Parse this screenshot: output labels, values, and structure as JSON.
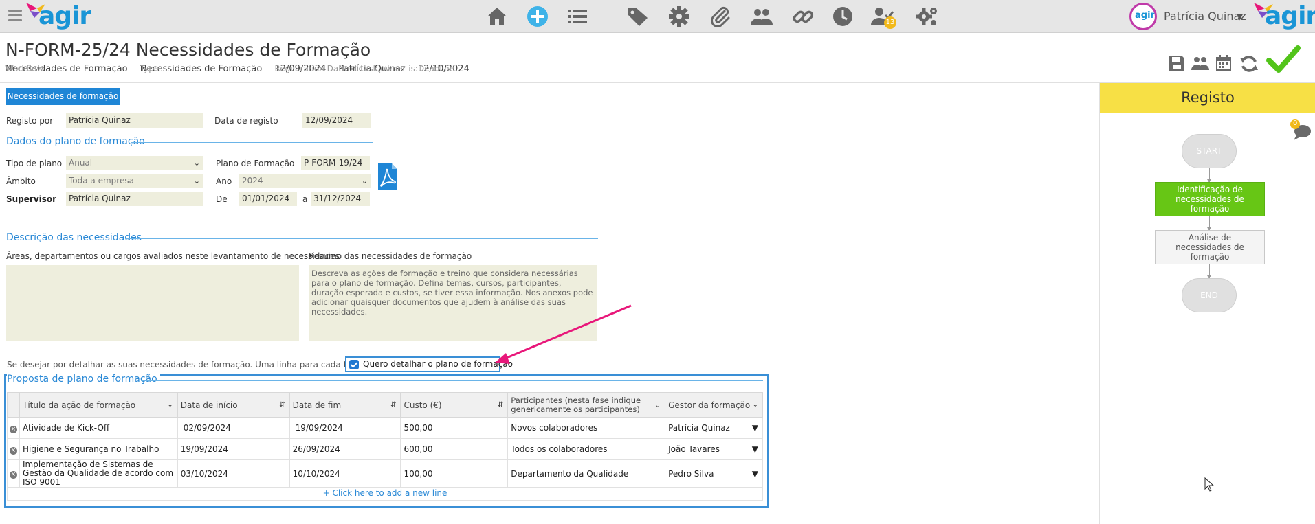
{
  "topbar": {
    "logo_text": "agir",
    "badge_count": "13",
    "user_name": "Patrícia Quinaz",
    "user_initials": "agir",
    "nav_icons": [
      "home-icon",
      "add-icon",
      "list-icon",
      "tag-icon",
      "gear-icon",
      "paperclip-icon",
      "users-icon",
      "link-icon",
      "clock-icon",
      "user-check-icon",
      "gears-icon"
    ]
  },
  "header": {
    "title": "N-FORM-25/24 Necessidades de Formação",
    "meta": [
      {
        "label": "Workflow",
        "value": "Necessidades de Formação"
      },
      {
        "label": "Type",
        "value": "Necessidades de Formação"
      },
      {
        "label": "Registration Date",
        "value": "12/09/2024"
      },
      {
        "label": "Next task owner is:",
        "value": "Patrícia Quinaz"
      },
      {
        "label": "Deadline",
        "value": "12/10/2024"
      }
    ],
    "toolbar_icons": [
      "save-icon",
      "users-icon",
      "calendar-icon",
      "refresh-icon",
      "check-icon"
    ]
  },
  "form": {
    "tab_label": "Necessidades de formação",
    "registo_por_label": "Registo por",
    "registo_por_value": "Patrícia Quinaz",
    "data_registo_label": "Data de registo",
    "data_registo_value": "12/09/2024",
    "section_plano": "Dados do plano de formação",
    "tipo_plano_label": "Tipo de plano",
    "tipo_plano_value": "Anual",
    "plano_formacao_label": "Plano de Formação",
    "plano_formacao_value": "P-FORM-19/24",
    "ambito_label": "Âmbito",
    "ambito_value": "Toda a empresa",
    "ano_label": "Ano",
    "ano_value": "2024",
    "supervisor_label": "Supervisor",
    "supervisor_value": "Patrícia Quinaz",
    "de_label": "De",
    "de_value": "01/01/2024",
    "a_label": "a",
    "a_value": "31/12/2024",
    "section_descricao": "Descrição das necessidades",
    "areas_label": "Áreas, departamentos ou cargos avaliados neste levantamento de necessidades",
    "areas_value": "",
    "resumo_label": "Resumo das necessidades de formação",
    "resumo_placeholder": "Descreva as ações de formação e treino que considera necessárias para o plano de formação. Defina temas, cursos, participantes, duração esperada e custos, se tiver essa informação. Nos anexos pode adicionar quaisquer documentos que ajudem à análise das suas necessidades.",
    "hint": "Se desejar por detalhar as suas necessidades de formação. Uma linha para cada formação.",
    "checkbox_label": "Quero detalhar o plano de formação",
    "checkbox_checked": true
  },
  "grid": {
    "title": "Proposta de plano de formação",
    "columns": [
      "Título da ação de formação",
      "Data de início",
      "Data de fim",
      "Custo (€)",
      "Participantes (nesta fase indique genericamente os participantes)",
      "Gestor da formação"
    ],
    "rows": [
      {
        "titulo": "Atividade de Kick-Off",
        "inicio": "02/09/2024",
        "fim": "19/09/2024",
        "custo": "500,00",
        "participantes": "Novos colaboradores",
        "gestor": "Patrícia Quinaz"
      },
      {
        "titulo": "Higiene e Segurança no Trabalho",
        "inicio": "19/09/2024",
        "fim": "26/09/2024",
        "custo": "600,00",
        "participantes": "Todos os colaboradores",
        "gestor": "João Tavares"
      },
      {
        "titulo": "Implementação de Sistemas de Gestão da Qualidade de acordo com ISO 9001",
        "inicio": "03/10/2024",
        "fim": "10/10/2024",
        "custo": "100,00",
        "participantes": "Departamento da Qualidade",
        "gestor": "Pedro Silva"
      }
    ],
    "add_line": "+ Click here to add a new line"
  },
  "workflow": {
    "stage_title": "Registo",
    "comment_count": "0",
    "nodes": [
      {
        "label": "START",
        "kind": "start"
      },
      {
        "label": "Identificação de necessidades de formação",
        "kind": "active"
      },
      {
        "label": "Análise de necessidades de formação",
        "kind": "step"
      },
      {
        "label": "END",
        "kind": "end"
      }
    ]
  },
  "colors": {
    "accent": "#1f86d6",
    "field_bg": "#eeeedd",
    "stage_header": "#f7e045",
    "active_step": "#67c615",
    "arrow": "#e8177a"
  }
}
